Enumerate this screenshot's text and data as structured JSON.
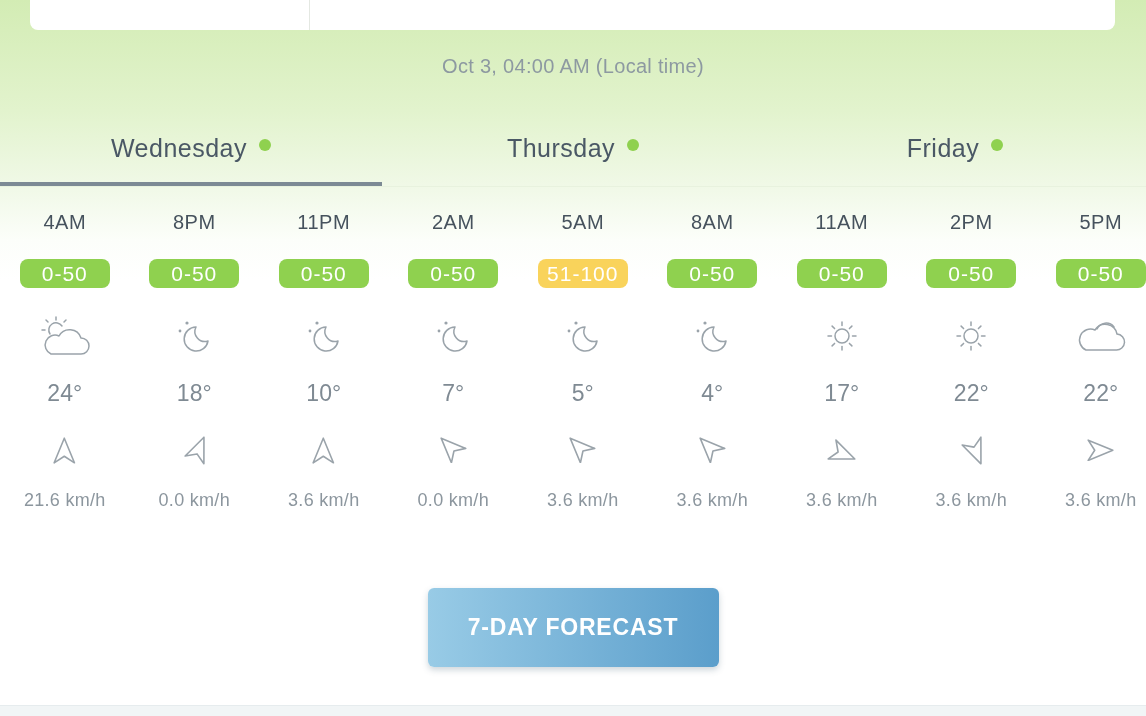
{
  "timestamp": "Oct 3, 04:00 AM (Local time)",
  "day_tabs": [
    {
      "label": "Wednesday",
      "selected": true,
      "color": "#8fd14f"
    },
    {
      "label": "Thursday",
      "selected": false,
      "color": "#8fd14f"
    },
    {
      "label": "Friday",
      "selected": false,
      "color": "#8fd14f"
    }
  ],
  "hourly": [
    {
      "time": "4AM",
      "aqi": "0-50",
      "color": "#8fd14f",
      "kind": "partly-cloudy",
      "temperature": "24°",
      "wind": {
        "kind": "n",
        "speed": "21.6 km/h"
      }
    },
    {
      "time": "8PM",
      "aqi": "0-50",
      "color": "#8fd14f",
      "kind": "clear-night",
      "temperature": "18°",
      "wind": {
        "kind": "nne",
        "speed": "0.0 km/h"
      }
    },
    {
      "time": "11PM",
      "aqi": "0-50",
      "color": "#8fd14f",
      "kind": "clear-night",
      "temperature": "10°",
      "wind": {
        "kind": "n",
        "speed": "3.6 km/h"
      }
    },
    {
      "time": "2AM",
      "aqi": "0-50",
      "color": "#8fd14f",
      "kind": "clear-night",
      "temperature": "7°",
      "wind": {
        "kind": "nw",
        "speed": "0.0 km/h"
      }
    },
    {
      "time": "5AM",
      "aqi": "51-100",
      "color": "#f9d35b",
      "kind": "clear-night",
      "temperature": "5°",
      "wind": {
        "kind": "nw",
        "speed": "3.6 km/h"
      }
    },
    {
      "time": "8AM",
      "aqi": "0-50",
      "color": "#8fd14f",
      "kind": "clear-night",
      "temperature": "4°",
      "wind": {
        "kind": "nw",
        "speed": "3.6 km/h"
      }
    },
    {
      "time": "11AM",
      "aqi": "0-50",
      "color": "#8fd14f",
      "kind": "sunny",
      "temperature": "17°",
      "wind": {
        "kind": "ese",
        "speed": "3.6 km/h"
      }
    },
    {
      "time": "2PM",
      "aqi": "0-50",
      "color": "#8fd14f",
      "kind": "sunny",
      "temperature": "22°",
      "wind": {
        "kind": "sse",
        "speed": "3.6 km/h"
      }
    },
    {
      "time": "5PM",
      "aqi": "0-50",
      "color": "#8fd14f",
      "kind": "cloudy",
      "temperature": "22°",
      "wind": {
        "kind": "e",
        "speed": "3.6 km/h"
      }
    }
  ],
  "forecast_button": "7-DAY FORECAST"
}
